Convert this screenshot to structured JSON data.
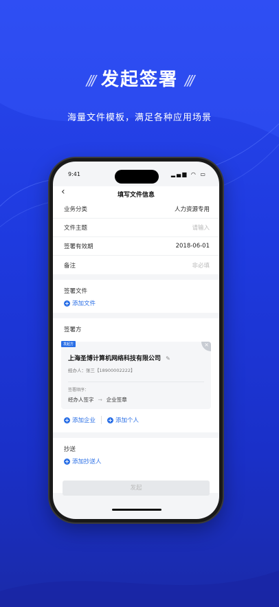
{
  "hero": {
    "title": "发起签署",
    "slash_left": "///",
    "slash_right": "///",
    "subtitle": "海量文件模板，满足各种应用场景"
  },
  "status_bar": {
    "time": "9:41",
    "icons": "▂▄▆ ◠ ▭"
  },
  "navbar": {
    "back_icon": "‹",
    "title": "填写文件信息"
  },
  "form": {
    "fields": [
      {
        "label": "业务分类",
        "value": "人力资源专用",
        "placeholder": ""
      },
      {
        "label": "文件主题",
        "value": "",
        "placeholder": "请输入"
      },
      {
        "label": "签署有效期",
        "value": "2018-06-01",
        "placeholder": ""
      },
      {
        "label": "备注",
        "value": "",
        "placeholder": "非必填"
      }
    ]
  },
  "sign_files": {
    "title": "签署文件",
    "add_label": "添加文件"
  },
  "signers": {
    "title": "签署方",
    "card": {
      "tag": "发起方",
      "company": "上海圣博计算机网络科技有限公司",
      "handler": "经办人：张三【18900002222】",
      "order_label": "签署顺序：",
      "step1": "经办人签字",
      "arrow": "→",
      "step2": "企业签章"
    },
    "add_company": "添加企业",
    "add_person": "添加个人"
  },
  "cc": {
    "title": "抄送",
    "add_label": "添加抄送人"
  },
  "submit_label": "发起",
  "colors": {
    "accent": "#2a6fe6",
    "bg": "#2a48ee"
  }
}
